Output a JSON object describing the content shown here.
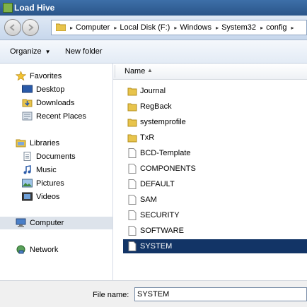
{
  "window": {
    "title": "Load Hive"
  },
  "address": {
    "crumbs": [
      "Computer",
      "Local Disk (F:)",
      "Windows",
      "System32",
      "config"
    ]
  },
  "toolbar": {
    "organize_label": "Organize",
    "new_folder_label": "New folder"
  },
  "nav": {
    "favorites": {
      "label": "Favorites",
      "items": [
        "Desktop",
        "Downloads",
        "Recent Places"
      ]
    },
    "libraries": {
      "label": "Libraries",
      "items": [
        "Documents",
        "Music",
        "Pictures",
        "Videos"
      ]
    },
    "computer": {
      "label": "Computer",
      "selected": true
    },
    "network": {
      "label": "Network"
    }
  },
  "filelist": {
    "column_name": "Name",
    "folders": [
      "Journal",
      "RegBack",
      "systemprofile",
      "TxR"
    ],
    "files": [
      "BCD-Template",
      "COMPONENTS",
      "DEFAULT",
      "SAM",
      "SECURITY",
      "SOFTWARE",
      "SYSTEM"
    ],
    "selected": "SYSTEM"
  },
  "filename": {
    "label": "File name:",
    "value": "SYSTEM"
  },
  "colors": {
    "selection": "#123466",
    "titlebar": "#2a5589"
  }
}
